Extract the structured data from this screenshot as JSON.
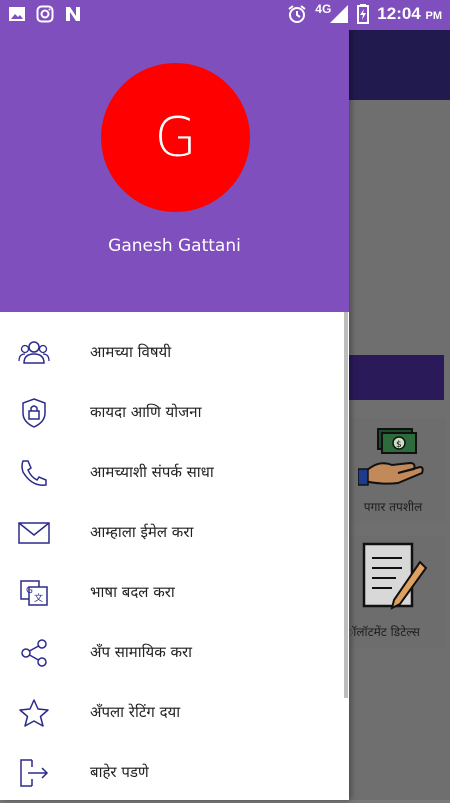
{
  "status_bar": {
    "time": "12:04",
    "ampm": "PM",
    "network": "4G",
    "left_icons": [
      "image-icon",
      "instagram-icon",
      "n-icon"
    ],
    "right_icons": [
      "alarm-icon",
      "signal-icon",
      "battery-icon"
    ]
  },
  "drawer": {
    "avatar_initial": "G",
    "avatar_color": "#ff0000",
    "header_color": "#7e4fbd",
    "user_name": "Ganesh Gattani",
    "items": [
      {
        "label": "आमच्या विषयी",
        "icon": "people-icon"
      },
      {
        "label": "कायदा आणि योजना",
        "icon": "lock-icon"
      },
      {
        "label": "आमच्याशी संपर्क साधा",
        "icon": "phone-icon"
      },
      {
        "label": "आम्हाला ईमेल करा",
        "icon": "mail-icon"
      },
      {
        "label": "भाषा बदल करा",
        "icon": "translate-icon"
      },
      {
        "label": "अँप सामायिक करा",
        "icon": "share-icon"
      },
      {
        "label": "अँपला रेटिंग दया",
        "icon": "star-icon"
      },
      {
        "label": "बाहेर पडणे",
        "icon": "logout-icon"
      }
    ]
  },
  "background": {
    "cards": [
      {
        "label": "पगार तपशील",
        "icon": "salary-icon"
      },
      {
        "label": "ॉलॉटमेंट डिटेल्स",
        "icon": "document-pen-icon"
      }
    ]
  }
}
